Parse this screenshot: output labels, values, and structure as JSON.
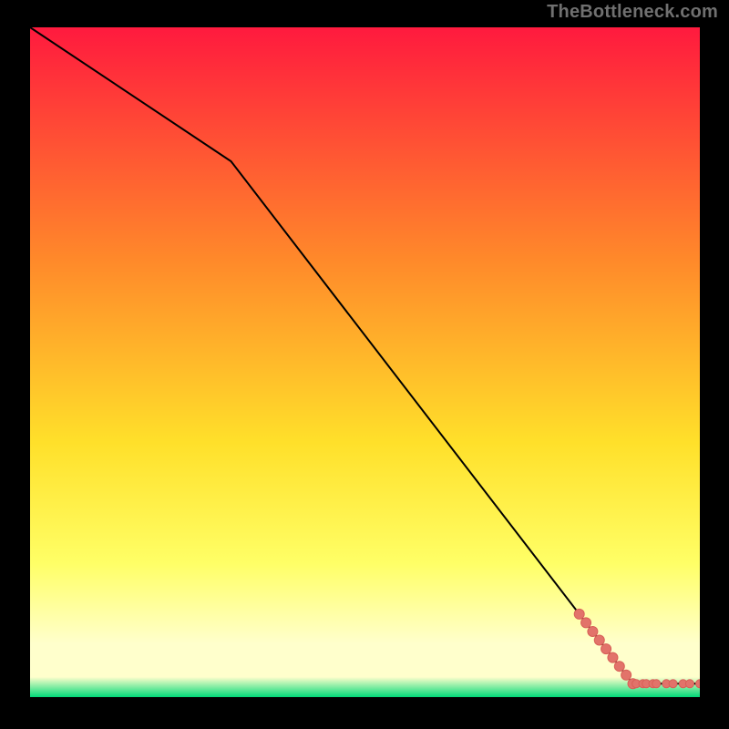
{
  "watermark": "TheBottleneck.com",
  "colors": {
    "background": "#000000",
    "gradient_top": "#ff1a3e",
    "gradient_mid_upper": "#ff8a2a",
    "gradient_mid": "#ffe02a",
    "gradient_lower": "#ffff66",
    "gradient_pale": "#ffffcc",
    "gradient_bottom": "#00d978",
    "line": "#000000",
    "marker_fill": "#e2736a",
    "marker_stroke": "#d85f57"
  },
  "chart_data": {
    "type": "line",
    "title": "",
    "xlabel": "",
    "ylabel": "",
    "xlim": [
      0,
      100
    ],
    "ylim": [
      0,
      100
    ],
    "series": [
      {
        "name": "curve",
        "x": [
          0,
          30,
          90,
          100
        ],
        "y": [
          100,
          80,
          2,
          2
        ]
      }
    ],
    "markers": {
      "name": "points-on-curve",
      "x": [
        82,
        83,
        84,
        85,
        86,
        87,
        88,
        89,
        90,
        90.5,
        91.5,
        92,
        93,
        93.5,
        95,
        96,
        97.5,
        98.5,
        100
      ],
      "y": [
        12.4,
        11.1,
        9.8,
        8.5,
        7.2,
        5.9,
        4.6,
        3.3,
        2.0,
        2.0,
        2.0,
        2.0,
        2.0,
        2.0,
        2.0,
        2.0,
        2.0,
        2.0,
        2.0
      ]
    }
  }
}
